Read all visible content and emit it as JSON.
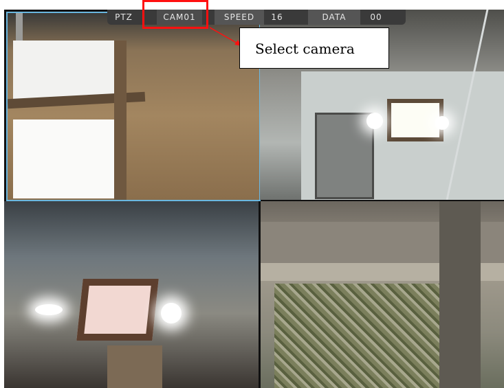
{
  "osd": {
    "ptz_label": "PTZ",
    "camera": "CAM01",
    "speed_label": "SPEED",
    "speed_value": "16",
    "data_label": "DATA",
    "data_value": "00"
  },
  "annotation": {
    "callout_text": "Select camera",
    "highlight_color": "#ff1010"
  },
  "cameras": [
    {
      "id": "01",
      "timestamp": "",
      "selected": true,
      "border_color": "#6ab7e0"
    },
    {
      "id": "02",
      "timestamp": "",
      "selected": false
    },
    {
      "id": "03",
      "timestamp": "",
      "selected": false
    },
    {
      "id": "04",
      "timestamp": "",
      "selected": false
    }
  ]
}
